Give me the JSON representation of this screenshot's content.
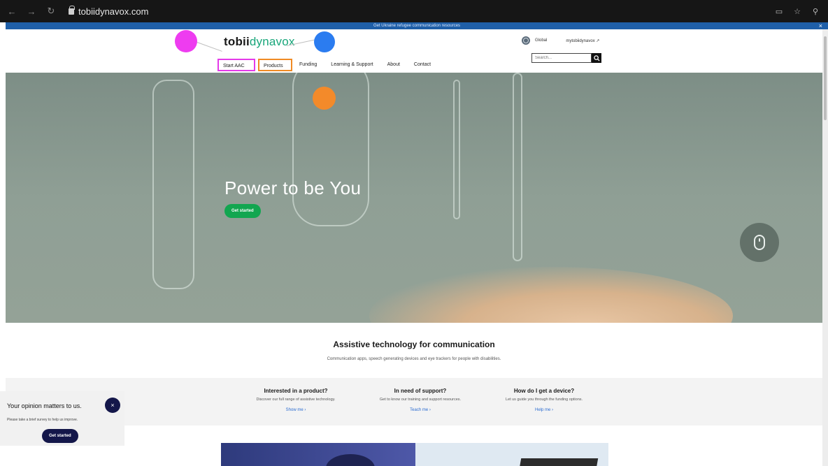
{
  "browser": {
    "url": "tobiidynavox.com"
  },
  "banner": {
    "text": "Get Ukraine refugee communication resources",
    "close": "×"
  },
  "header": {
    "logo_bold": "tobii",
    "logo_light": "dynavox",
    "global_label": "Global",
    "account_link": "mytobiidynavox ↗",
    "search_placeholder": "Search...",
    "nav": [
      "Start AAC",
      "Products",
      "Funding",
      "Learning & Support",
      "About",
      "Contact"
    ]
  },
  "hero": {
    "title": "Power to be You",
    "cta": "Get started"
  },
  "intro": {
    "title": "Assistive technology for communication",
    "subtitle": "Communication apps, speech generating devices and eye trackers for people with disabilities."
  },
  "features": [
    {
      "title": "Interested in a product?",
      "desc": "Discover our full range of assistive technology.",
      "link": "Show me ›"
    },
    {
      "title": "In need of support?",
      "desc": "Get to know our training and support resources.",
      "link": "Teach me ›"
    },
    {
      "title": "How do I get a device?",
      "desc": "Let us guide you through the funding options.",
      "link": "Help me ›"
    }
  ],
  "survey": {
    "title": "Your opinion matters to us.",
    "desc": "Please take a brief survey to help us improve.",
    "cta": "Get started",
    "close": "×"
  },
  "annotation_colors": {
    "magenta": "#ee3cf0",
    "blue": "#2b7cf0",
    "orange": "#f38a2a"
  },
  "accent_colors": {
    "cta_green": "#12a650",
    "navy": "#14174a",
    "banner_blue": "#1f5fa8"
  }
}
